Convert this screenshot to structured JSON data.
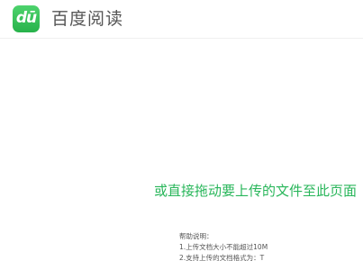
{
  "header": {
    "logo_text": "dū",
    "app_name": "百度阅读"
  },
  "upload": {
    "drop_hint": "或直接拖动要上传的文件至此页面",
    "help_title": "帮助说明：",
    "help_items": [
      "1.上传文档大小不能超过10M",
      "2.支持上传的文档格式为：T"
    ]
  }
}
